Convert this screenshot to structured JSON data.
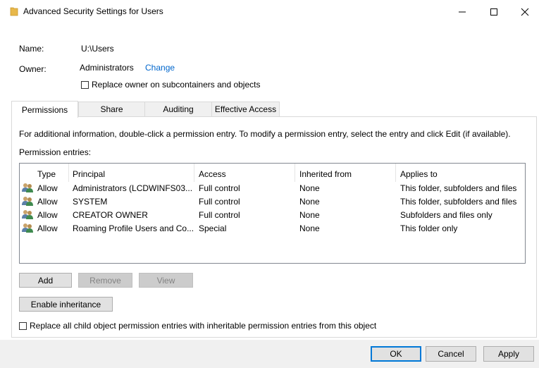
{
  "window": {
    "title": "Advanced Security Settings for Users",
    "minimize_glyph": "—",
    "maximize_glyph": "☐",
    "close_glyph": "✕"
  },
  "header": {
    "name_label": "Name:",
    "name_value": "U:\\Users",
    "owner_label": "Owner:",
    "owner_value": "Administrators",
    "change_link": "Change",
    "replace_owner_label": "Replace owner on subcontainers and objects"
  },
  "tabs": [
    {
      "label": "Permissions",
      "active": true
    },
    {
      "label": "Share",
      "active": false
    },
    {
      "label": "Auditing",
      "active": false
    },
    {
      "label": "Effective Access",
      "active": false
    }
  ],
  "permissions": {
    "info_text": "For additional information, double-click a permission entry. To modify a permission entry, select the entry and click Edit (if available).",
    "entries_label": "Permission entries:",
    "columns": [
      "Type",
      "Principal",
      "Access",
      "Inherited from",
      "Applies to"
    ],
    "rows": [
      [
        "Allow",
        "Administrators (LCDWINFS03...",
        "Full control",
        "None",
        "This folder, subfolders and files"
      ],
      [
        "Allow",
        "SYSTEM",
        "Full control",
        "None",
        "This folder, subfolders and files"
      ],
      [
        "Allow",
        "CREATOR OWNER",
        "Full control",
        "None",
        "Subfolders and files only"
      ],
      [
        "Allow",
        "Roaming Profile Users and Co...",
        "Special",
        "None",
        "This folder only"
      ]
    ],
    "add_button": "Add",
    "remove_button": "Remove",
    "view_button": "View",
    "enable_inheritance_button": "Enable inheritance",
    "replace_child_label": "Replace all child object permission entries with inheritable permission entries from this object"
  },
  "footer": {
    "ok_button": "OK",
    "cancel_button": "Cancel",
    "apply_button": "Apply"
  },
  "colors": {
    "link": "#0066cc",
    "default_button_border": "#0078d7",
    "folder": "#e8b84a"
  },
  "icons": [
    "folder-icon",
    "users-icon"
  ]
}
